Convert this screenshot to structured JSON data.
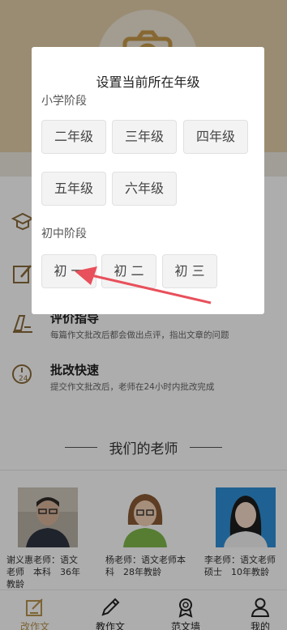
{
  "modal": {
    "title": "设置当前所在年级",
    "primary_label": "小学阶段",
    "primary_grades": [
      "二年级",
      "三年级",
      "四年级",
      "五年级",
      "六年级"
    ],
    "middle_label": "初中阶段",
    "middle_grades": [
      "初 一",
      "初 二",
      "初 三"
    ]
  },
  "features": [
    {
      "title": "",
      "desc": "",
      "icon": "graduation-cap-icon"
    },
    {
      "title": "",
      "desc": "",
      "icon": "edit-icon"
    },
    {
      "title": "评价指导",
      "desc": "每篇作文批改后都会做出点评，指出文章的问题",
      "icon": "pen-icon"
    },
    {
      "title": "批改快速",
      "desc": "提交作文批改后，老师在24小时内批改完成",
      "icon": "24-hour-clock-icon"
    }
  ],
  "teachers_heading": "我们的老师",
  "teachers": [
    {
      "text": "谢义惠老师：语文老师　本科　36年教龄"
    },
    {
      "text": "杨老师：语文老师本科　28年教龄"
    },
    {
      "text": "李老师：语文老师硕士　10年教龄"
    }
  ],
  "tabs": [
    {
      "label": "改作文",
      "icon": "edit-square-icon",
      "active": true
    },
    {
      "label": "教作文",
      "icon": "pencil-icon",
      "active": false
    },
    {
      "label": "范文墙",
      "icon": "award-badge-icon",
      "active": false
    },
    {
      "label": "我的",
      "icon": "user-icon",
      "active": false
    }
  ],
  "colors": {
    "accent": "#b8944f",
    "hero": "#e3cfa9",
    "annotation_arrow": "#e8505b"
  }
}
